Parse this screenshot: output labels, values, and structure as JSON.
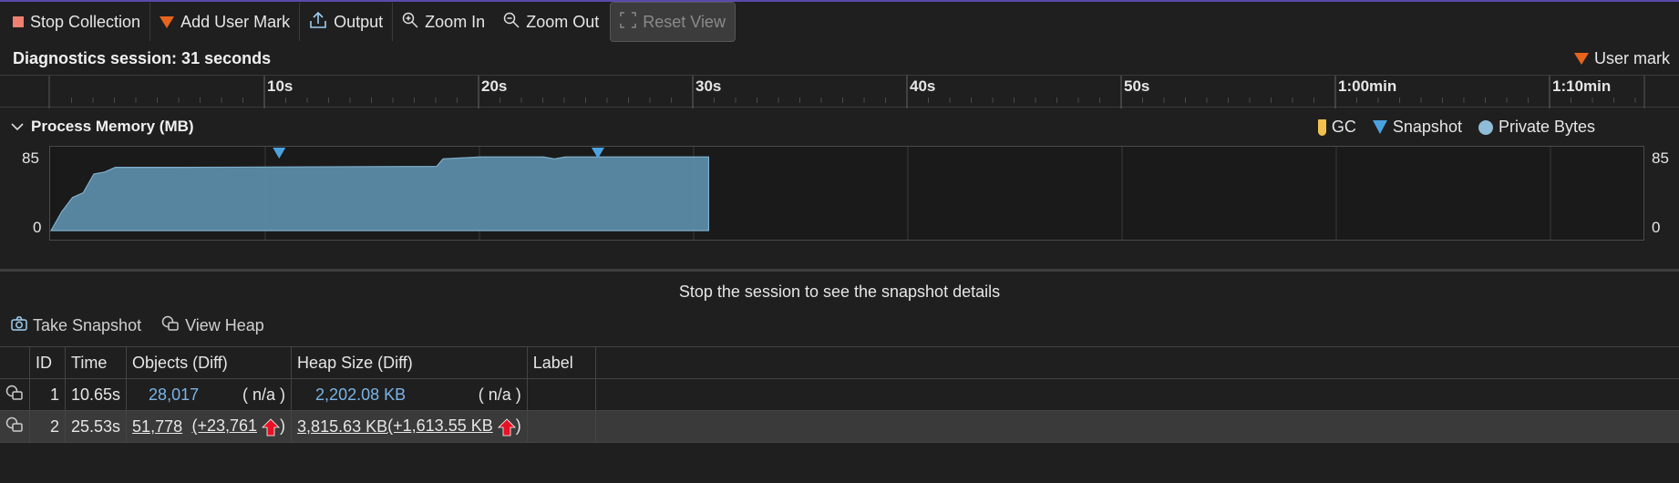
{
  "toolbar": {
    "stop_collection": "Stop Collection",
    "add_user_mark": "Add User Mark",
    "output": "Output",
    "zoom_in": "Zoom In",
    "zoom_out": "Zoom Out",
    "reset_view": "Reset View"
  },
  "session": {
    "title": "Diagnostics session: 31 seconds",
    "user_mark_label": "User mark"
  },
  "ruler": {
    "ticks": [
      "10s",
      "20s",
      "30s",
      "40s",
      "50s",
      "1:00min",
      "1:10min"
    ]
  },
  "process_memory": {
    "title": "Process Memory (MB)",
    "legend": {
      "gc": "GC",
      "snapshot": "Snapshot",
      "private_bytes": "Private Bytes"
    },
    "y_max_label": "85",
    "y_min_label": "0"
  },
  "chart_data": {
    "type": "area",
    "title": "Process Memory (MB)",
    "xlabel": "",
    "ylabel": "",
    "ylim": [
      0,
      85
    ],
    "x_unit": "seconds",
    "xlim": [
      0,
      74.5
    ],
    "series": [
      {
        "name": "Private Bytes",
        "color": "#5b8aa6",
        "x": [
          0,
          0.5,
          1,
          1.5,
          2,
          2.5,
          3,
          4,
          6,
          18,
          18.3,
          20,
          23,
          23.5,
          24,
          25,
          30.7,
          30.7
        ],
        "y": [
          0,
          20,
          35,
          40,
          60,
          62,
          67,
          67,
          67,
          68,
          76,
          78,
          78,
          76,
          78,
          78,
          78,
          0
        ]
      }
    ],
    "snapshots_x": [
      10.65,
      25.53
    ]
  },
  "stop_message": "Stop the session to see the snapshot details",
  "snapshot_toolbar": {
    "take_snapshot": "Take Snapshot",
    "view_heap": "View Heap"
  },
  "table": {
    "headers": [
      "ID",
      "Time",
      "Objects (Diff)",
      "Heap Size (Diff)",
      "Label"
    ],
    "rows": [
      {
        "id": "1",
        "time": "10.65s",
        "objects": "28,017",
        "objects_diff": "( n/a )",
        "heap": "2,202.08 KB",
        "heap_diff": "( n/a )",
        "label": ""
      },
      {
        "id": "2",
        "time": "25.53s",
        "objects": "51,778",
        "objects_diff": "(+23,761",
        "heap": "3,815.63 KB",
        "heap_diff": "(+1,613.55 KB",
        "label": ""
      }
    ]
  },
  "colors": {
    "accent_mark": "#e8641c",
    "snapshot": "#4aa3df",
    "gc": "#f2c14e",
    "link": "#7ab4e8",
    "increase_arrow": "#e81123"
  }
}
